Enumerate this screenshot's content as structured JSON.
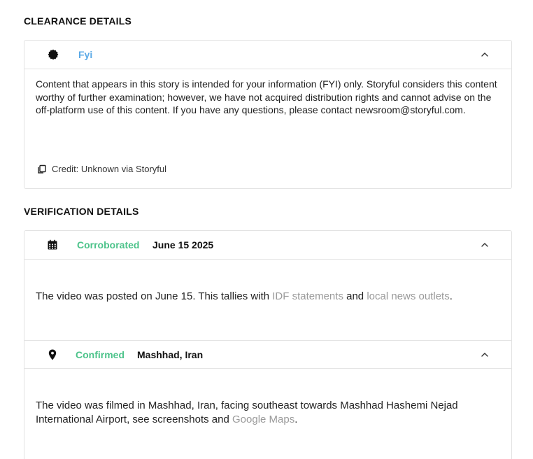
{
  "clearance": {
    "section_title": "CLEARANCE DETAILS",
    "status_label": "Fyi",
    "status_icon": "badge-icon",
    "status_color": "#5aa9e6",
    "body_text": "Content that appears in this story is intended for your information (FYI) only. Storyful considers this content worthy of further examination; however, we have not acquired distribution rights and cannot advise on the off-platform use of this content. If you have any questions, please contact newsroom@storyful.com.",
    "credit_text": "Credit: Unknown via Storyful",
    "credit_icon": "copy-icon"
  },
  "verification": {
    "section_title": "VERIFICATION DETAILS",
    "items": [
      {
        "icon": "calendar-icon",
        "status_label": "Corroborated",
        "status_color": "#4cc38a",
        "meta": "June 15 2025",
        "text_prefix": "The video was posted on June 15. This tallies with ",
        "link1": "IDF statements",
        "text_mid": " and ",
        "link2": "local news outlets",
        "text_suffix": "."
      },
      {
        "icon": "map-pin-icon",
        "status_label": "Confirmed",
        "status_color": "#4cc38a",
        "meta": "Mashhad, Iran",
        "text_prefix": "The video was filmed in Mashhad, Iran, facing southeast towards Mashhad Hashemi Nejad International Airport, see screenshots and ",
        "link1": "Google Maps",
        "text_suffix": "."
      }
    ]
  }
}
